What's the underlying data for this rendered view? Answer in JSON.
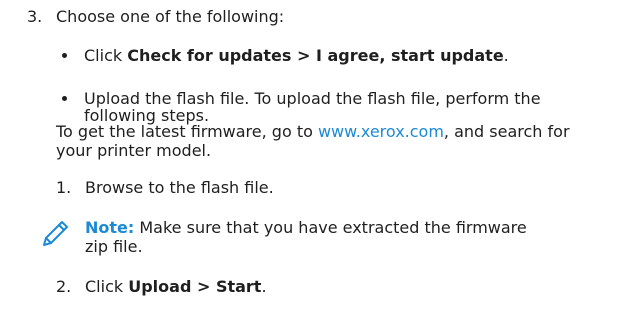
{
  "step3": {
    "number": "3.",
    "intro": "Choose one of the following:"
  },
  "option1": {
    "prefix": "Click ",
    "path": "Check for updates > I agree, start update",
    "suffix": "."
  },
  "option2": {
    "line1": "Upload the flash file. To upload the flash file, perform the",
    "line2": "following steps."
  },
  "firmware": {
    "before": "To get the latest firmware, go to ",
    "link": "www.xerox.com",
    "after": ", and search for",
    "line2": "your printer model."
  },
  "substep1": {
    "number": "1.",
    "text": "Browse to the flash file."
  },
  "note": {
    "icon": "pencil-icon",
    "label": "Note:",
    "line1": " Make sure that you have extracted the firmware",
    "line2": "zip file."
  },
  "substep2": {
    "number": "2.",
    "prefix": "Click ",
    "path": "Upload > Start",
    "suffix": "."
  },
  "colors": {
    "link": "#1c8ad6",
    "text": "#1f1f1f"
  }
}
